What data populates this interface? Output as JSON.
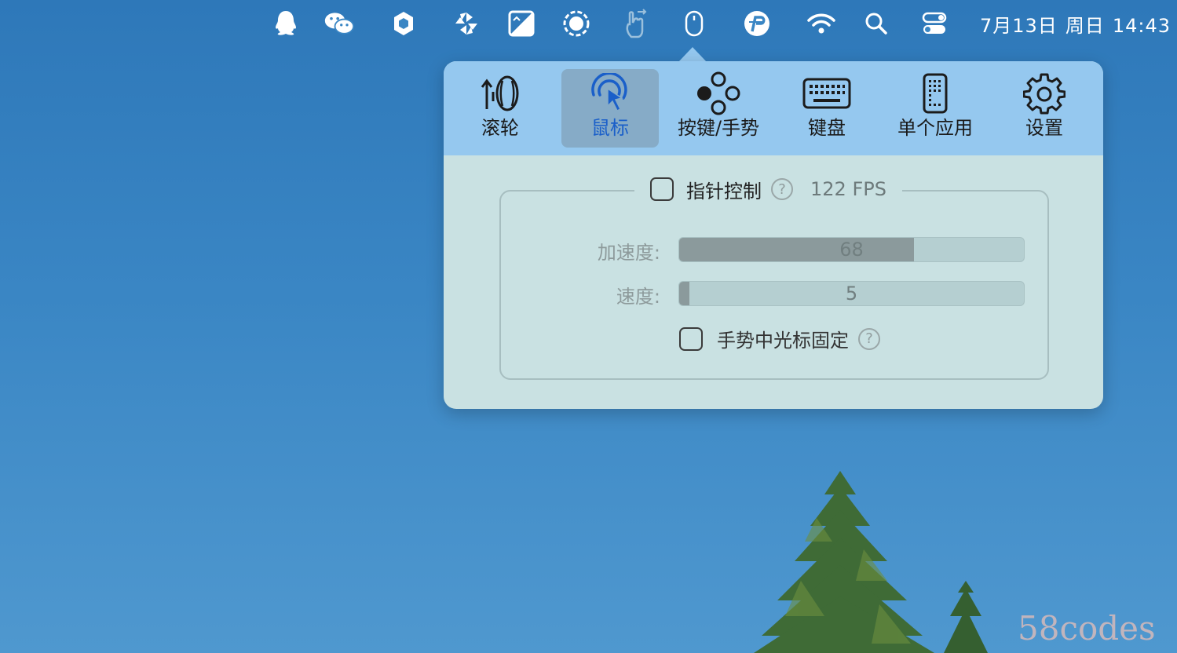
{
  "menubar": {
    "icons": [
      "qq-icon",
      "wechat-icon",
      "hexagon-app-icon",
      "pinwheel-app-icon",
      "photo-edit-icon",
      "screen-record-icon",
      "hand-gesture-icon",
      "mouse-icon",
      "p-app-icon",
      "wifi-icon",
      "search-icon",
      "control-center-icon"
    ],
    "date": "7月13日",
    "weekday": "周日",
    "time": "14:43"
  },
  "popover": {
    "tabs": [
      {
        "label": "滚轮",
        "icon": "scroll-wheel-icon"
      },
      {
        "label": "鼠标",
        "icon": "cursor-click-icon"
      },
      {
        "label": "按键/手势",
        "icon": "buttons-gesture-icon"
      },
      {
        "label": "键盘",
        "icon": "keyboard-icon"
      },
      {
        "label": "单个应用",
        "icon": "single-app-icon"
      },
      {
        "label": "设置",
        "icon": "gear-icon"
      }
    ],
    "active_tab": "鼠标",
    "pointer_control": {
      "label": "指针控制",
      "help": "?",
      "fps": "122 FPS",
      "checked": false
    },
    "acceleration": {
      "label": "加速度:",
      "value": "68",
      "fraction": 0.68
    },
    "speed": {
      "label": "速度:",
      "value": "5",
      "fraction": 0.03
    },
    "lock_cursor": {
      "label": "手势中光标固定",
      "help": "?",
      "checked": false
    }
  },
  "watermark": "58codes",
  "colors": {
    "accent": "#1a5fc9",
    "toolbar": "#95c8ef",
    "panel": "#c9e1e2",
    "desktop": "#3a86c4"
  }
}
